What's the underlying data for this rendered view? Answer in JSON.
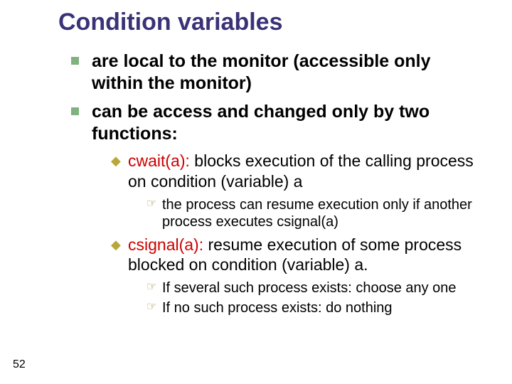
{
  "title": "Condition variables",
  "lvl1": [
    "are local to the monitor (accessible only within the monitor)",
    "can be access and changed only by two functions:"
  ],
  "cwait": {
    "term": "cwait(a):",
    "desc": " blocks execution of the calling process on condition (variable) a"
  },
  "cwait_sub": "the process can resume execution only if another process executes csignal(a)",
  "csignal": {
    "term": "csignal(a):",
    "desc": " resume execution of some process blocked on condition (variable) a."
  },
  "csignal_sub1": "If several such process exists: choose any one",
  "csignal_sub2": "If no such process exists: do nothing",
  "page": "52"
}
